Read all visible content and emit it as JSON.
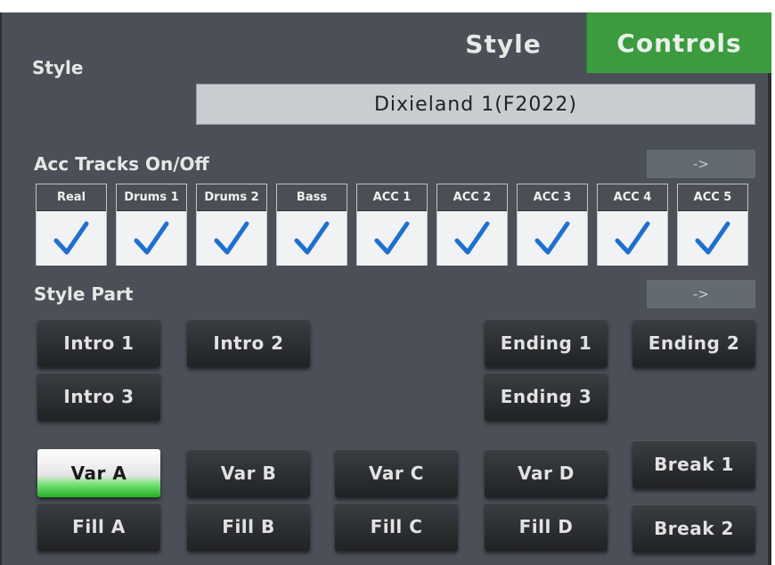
{
  "header": {
    "section_label": "Style",
    "tab_style": "Style",
    "tab_controls": "Controls"
  },
  "style_name": "Dixieland 1(F2022)",
  "acc_tracks": {
    "label": "Acc Tracks On/Off",
    "arrow": "->",
    "tracks": [
      {
        "label": "Real",
        "checked": true
      },
      {
        "label": "Drums 1",
        "checked": true
      },
      {
        "label": "Drums 2",
        "checked": true
      },
      {
        "label": "Bass",
        "checked": true
      },
      {
        "label": "ACC 1",
        "checked": true
      },
      {
        "label": "ACC 2",
        "checked": true
      },
      {
        "label": "ACC 3",
        "checked": true
      },
      {
        "label": "ACC 4",
        "checked": true
      },
      {
        "label": "ACC 5",
        "checked": true
      }
    ]
  },
  "style_part": {
    "label": "Style Part",
    "arrow": "->",
    "intro1": "Intro 1",
    "intro2": "Intro 2",
    "intro3": "Intro 3",
    "ending1": "Ending 1",
    "ending2": "Ending 2",
    "ending3": "Ending 3",
    "var_a": "Var A",
    "var_b": "Var B",
    "var_c": "Var C",
    "var_d": "Var D",
    "fill_a": "Fill A",
    "fill_b": "Fill B",
    "fill_c": "Fill C",
    "fill_d": "Fill D",
    "break1": "Break 1",
    "break2": "Break 2",
    "active": "Var A"
  },
  "colors": {
    "panel": "#4b5058",
    "controls_tab": "#3c9a3f",
    "check": "#1f6fd1",
    "active_glow": "#24b124"
  },
  "icons": {
    "check": "checkmark-icon",
    "arrow": "arrow-right-icon"
  }
}
